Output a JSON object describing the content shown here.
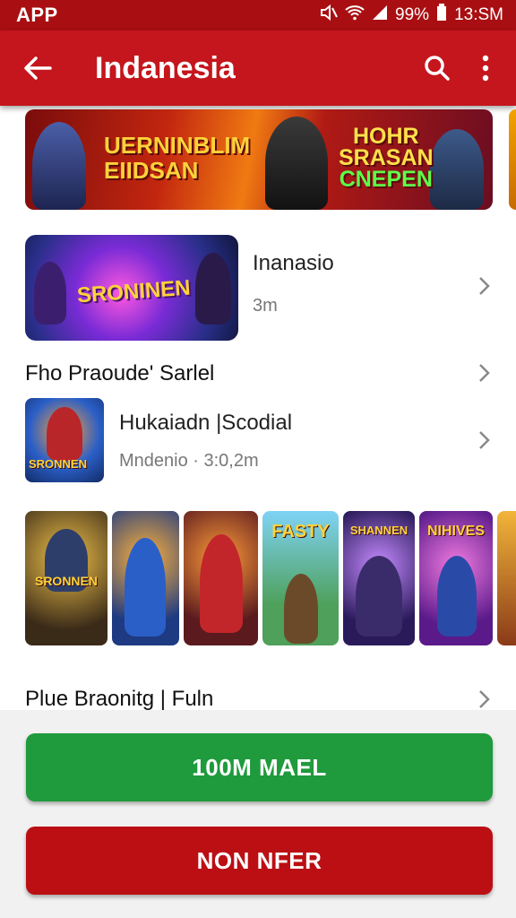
{
  "status_bar": {
    "app": "APP",
    "battery": "99%",
    "time": "13:SM",
    "icons": [
      "mute-icon",
      "wifi-icon",
      "signal-icon",
      "battery-icon"
    ]
  },
  "appbar": {
    "title": "Indanesia",
    "icons": [
      "back-arrow-icon",
      "search-icon",
      "more-vertical-icon"
    ]
  },
  "banner": {
    "left_text": "UERNINBLIM EIIDSAN",
    "right_text_line1": "HOHR",
    "right_text_line2": "SRASAN",
    "right_text_line3": "CNEPEN"
  },
  "featured": {
    "image_text": "SRONINEN",
    "title": "Inanasio",
    "subtitle": "3m"
  },
  "section1": {
    "title": "Fho Praoude' Sarlel"
  },
  "item2": {
    "image_text": "SRONNEN",
    "title": "Hukaiadn |Scodial",
    "subtitle": "Mndenio · 3:0,2m"
  },
  "strip": {
    "tiles": [
      {
        "text": "SRONNEN",
        "accent": "#d9a12a"
      },
      {
        "text": "",
        "accent": "#2a5fc7"
      },
      {
        "text": "",
        "accent": "#b0262a"
      },
      {
        "text": "FASTY",
        "accent": "#2f9a6a"
      },
      {
        "text": "SHANNEN",
        "accent": "#7a3bd6"
      },
      {
        "text": "NIHIVES",
        "accent": "#b23ad0"
      },
      {
        "text": "",
        "accent": "#e5a01a"
      }
    ]
  },
  "section2": {
    "title": "Plue Braonitg | Fuln"
  },
  "buttons": {
    "primary": "100M MAEL",
    "secondary": "NON NFER"
  },
  "colors": {
    "brand_red": "#c4161c",
    "status_red": "#a90f12",
    "green": "#1f9a3c",
    "button_red": "#bb0f14"
  }
}
